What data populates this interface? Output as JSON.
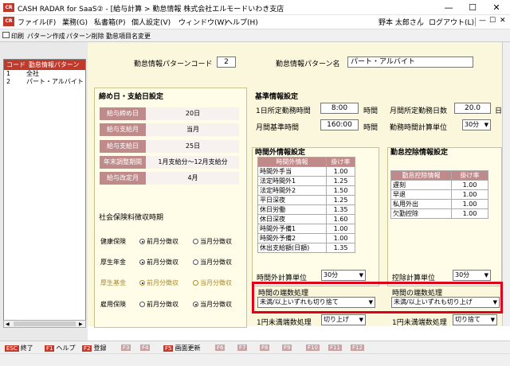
{
  "window": {
    "app_icon": "CR",
    "title": "CASH RADAR for SaaS② - [給与計算 > 勤怠情報 株式会社エルモードいわき支店",
    "min_glyph": "—",
    "max_glyph": "☐",
    "close_glyph": "✕"
  },
  "menu": {
    "items": [
      "ファイル(F)",
      "業務(G)",
      "私書箱(P)",
      "個人設定(V)",
      "ウィンドウ(W)",
      "ヘルプ(H)"
    ],
    "user": "野本 太郎さん",
    "logout": "ログアウト(L)"
  },
  "toolbar": {
    "print": "印刷",
    "create": "パターン作成",
    "delete": "パターン削除",
    "rename": "勤怠項目名変更"
  },
  "pattern_list": {
    "headers": [
      "コード",
      "勤怠情報パターン名"
    ],
    "rows": [
      {
        "code": "1",
        "name": "全社"
      },
      {
        "code": "2",
        "name": "パート・アルバイト"
      }
    ]
  },
  "header_fields": {
    "code_label": "勤怠情報パターンコード",
    "code_value": "2",
    "name_label": "勤怠情報パターン名",
    "name_value": "パート・アルバイト"
  },
  "closing": {
    "title": "締め日・支給日設定",
    "rows": [
      {
        "label": "給与締め日",
        "value": "20日"
      },
      {
        "label": "給与支給月",
        "value": "当月"
      },
      {
        "label": "給与支給日",
        "value": "25日"
      },
      {
        "label": "年末調整期間",
        "value": "1月支給分～12月支給分"
      },
      {
        "label": "給与改定月",
        "value": "4月"
      }
    ],
    "social_title": "社会保険料徴収時期",
    "social": [
      {
        "label": "健康保険",
        "opt1": "前月分徴収",
        "opt2": "当月分徴収",
        "selected": 1,
        "dim": false
      },
      {
        "label": "厚生年金",
        "opt1": "前月分徴収",
        "opt2": "当月分徴収",
        "selected": 1,
        "dim": false
      },
      {
        "label": "厚生基金",
        "opt1": "前月分徴収",
        "opt2": "当月分徴収",
        "selected": 1,
        "dim": true
      },
      {
        "label": "雇用保険",
        "opt1": "前月分徴収",
        "opt2": "当月分徴収",
        "selected": 2,
        "dim": false
      }
    ]
  },
  "basic": {
    "title": "基準情報設定",
    "daily_hours_label": "1日所定勤務時間",
    "daily_hours_value": "8:00",
    "hours_unit": "時間",
    "monthly_days_label": "月間所定勤務日数",
    "monthly_days_value": "20.0",
    "days_unit": "日",
    "monthly_base_label": "月間基準時間",
    "monthly_base_value": "160:00",
    "calc_unit_label": "勤務時間計算単位",
    "calc_unit_value": "30分"
  },
  "overtime": {
    "title": "時間外情報設定",
    "headers": [
      "時間外情報",
      "掛け率"
    ],
    "rows": [
      {
        "name": "時間外手当",
        "rate": "1.00"
      },
      {
        "name": "法定時間外1",
        "rate": "1.25"
      },
      {
        "name": "法定時間外2",
        "rate": "1.50"
      },
      {
        "name": "平日深夜",
        "rate": "1.25"
      },
      {
        "name": "休日労働",
        "rate": "1.35"
      },
      {
        "name": "休日深夜",
        "rate": "1.60"
      },
      {
        "name": "時間外予備1",
        "rate": "1.00"
      },
      {
        "name": "時間外予備2",
        "rate": "1.00"
      },
      {
        "name": "休出支給額(日額)",
        "rate": "1.35"
      }
    ],
    "unit_label": "時間外計算単位",
    "unit_value": "30分",
    "rounding_label": "時間の端数処理",
    "rounding_value": "未満/以上いずれも切り捨て",
    "yen_label": "1円未満端数処理",
    "yen_value": "切り上げ"
  },
  "deduction": {
    "title": "勤怠控除情報設定",
    "headers": [
      "勤怠控除情報",
      "掛け率"
    ],
    "rows": [
      {
        "name": "遅刻",
        "rate": "1.00"
      },
      {
        "name": "早退",
        "rate": "1.00"
      },
      {
        "name": "私用外出",
        "rate": "1.00"
      },
      {
        "name": "欠勤控除",
        "rate": "1.00"
      }
    ],
    "unit_label": "控除計算単位",
    "unit_value": "30分",
    "rounding_label": "時間の端数処理",
    "rounding_value": "未満/以上いずれも切り上げ",
    "yen_label": "1円未満端数処理",
    "yen_value": "切り捨て"
  },
  "fkeys": [
    {
      "key": "ESC",
      "label": "終了",
      "active": true
    },
    {
      "key": "F1",
      "label": "ヘルプ",
      "active": true
    },
    {
      "key": "F2",
      "label": "登録",
      "active": true
    },
    {
      "key": "F3",
      "label": "",
      "active": false
    },
    {
      "key": "F4",
      "label": "",
      "active": false
    },
    {
      "key": "F5",
      "label": "画面更新",
      "active": true
    },
    {
      "key": "F6",
      "label": "",
      "active": false
    },
    {
      "key": "F7",
      "label": "",
      "active": false
    },
    {
      "key": "F8",
      "label": "",
      "active": false
    },
    {
      "key": "F9",
      "label": "",
      "active": false
    },
    {
      "key": "F10",
      "label": "",
      "active": false
    },
    {
      "key": "F11",
      "label": "",
      "active": false
    },
    {
      "key": "F12",
      "label": "",
      "active": false
    }
  ],
  "colors": {
    "accent": "#c0392b",
    "highlight": "#e0001a",
    "panel": "#fffde8"
  }
}
